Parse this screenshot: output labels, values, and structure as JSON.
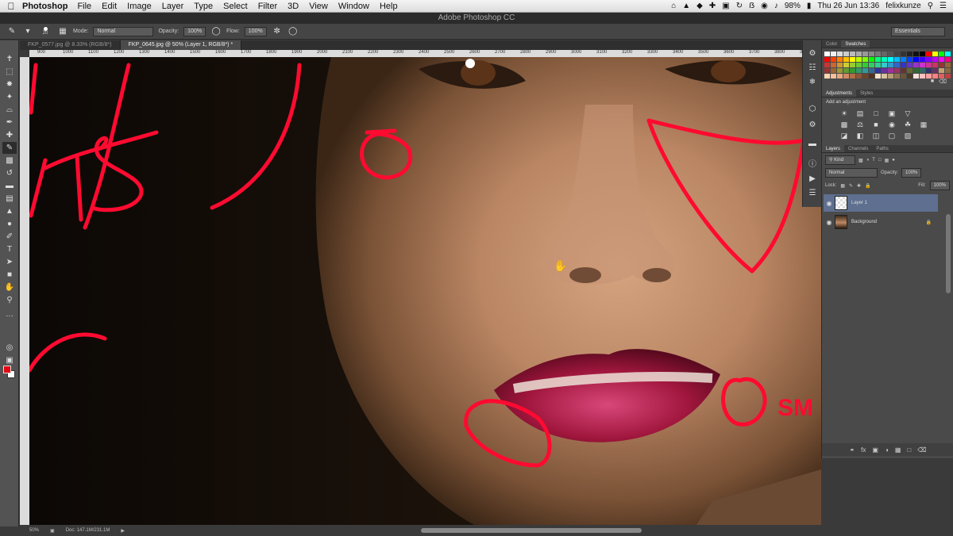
{
  "menubar": {
    "app": "Photoshop",
    "menus": [
      "File",
      "Edit",
      "Image",
      "Layer",
      "Type",
      "Select",
      "Filter",
      "3D",
      "View",
      "Window",
      "Help"
    ],
    "battery": "98%",
    "datetime": "Thu 26 Jun  13:36",
    "user": "felixkunze"
  },
  "window": {
    "title": "Adobe Photoshop CC"
  },
  "options": {
    "brush_size": "20",
    "mode_label": "Mode:",
    "mode_value": "Normal",
    "opacity_label": "Opacity:",
    "opacity_value": "100%",
    "flow_label": "Flow:",
    "flow_value": "100%",
    "workspace": "Essentials"
  },
  "tabs": [
    {
      "label": "FKP_0577.jpg @ 8.33% (RGB/8*)"
    },
    {
      "label": "FKP_0645.jpg @ 50% (Layer 1, RGB/8*) *"
    }
  ],
  "ruler_ticks": [
    "900",
    "1000",
    "1100",
    "1200",
    "1300",
    "1400",
    "1500",
    "1600",
    "1700",
    "1800",
    "1900",
    "2000",
    "2100",
    "2200",
    "2300",
    "2400",
    "2500",
    "2600",
    "2700",
    "2800",
    "2900",
    "3000",
    "3100",
    "3200",
    "3300",
    "3400",
    "3500",
    "3600",
    "3700",
    "3800",
    "3900"
  ],
  "annotations": {
    "corner_text": "SM"
  },
  "panels": {
    "color_tabs": [
      "Color",
      "Swatches"
    ],
    "adjustment_tabs": [
      "Adjustments",
      "Styles"
    ],
    "add_adjustment": "Add an adjustment",
    "layer_tabs": [
      "Layers",
      "Channels",
      "Paths"
    ],
    "kind_label": "Kind",
    "blend_mode": "Normal",
    "opacity_label": "Opacity:",
    "opacity_value": "100%",
    "lock_label": "Lock:",
    "fill_label": "Fill:",
    "fill_value": "100%",
    "layers": [
      {
        "name": "Layer 1"
      },
      {
        "name": "Background"
      }
    ]
  },
  "status": {
    "zoom": "50%",
    "doc": "Doc: 147.1M/231.1M"
  },
  "colors": {
    "foreground": "#e30613",
    "background": "#ffffff",
    "annotation_red": "#ff0a30"
  }
}
